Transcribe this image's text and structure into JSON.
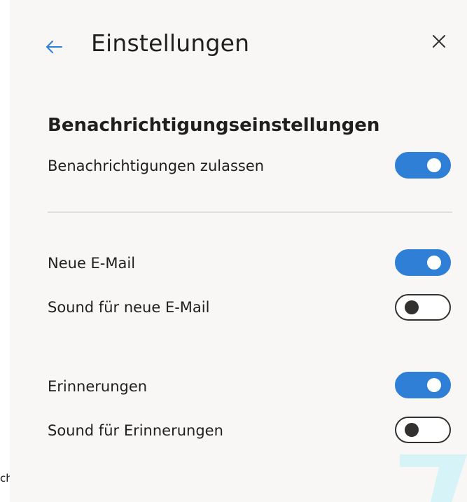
{
  "header": {
    "title": "Einstellungen"
  },
  "section": {
    "heading": "Benachrichtigungseinstellungen"
  },
  "settings": [
    {
      "label": "Benachrichtigungen zulassen",
      "enabled": true
    },
    {
      "label": "Neue E-Mail",
      "enabled": true
    },
    {
      "label": "Sound für neue E-Mail",
      "enabled": false
    },
    {
      "label": "Erinnerungen",
      "enabled": true
    },
    {
      "label": "Sound für Erinnerungen",
      "enabled": false
    }
  ],
  "background": {
    "partial_text": "ch"
  },
  "colors": {
    "accent": "#2f7fd6",
    "panel_background": "#f8f7f6",
    "text": "#201f1e",
    "watermark": "#d6f3f7"
  },
  "icons": {
    "back": "arrow-left-icon",
    "close": "close-icon"
  }
}
